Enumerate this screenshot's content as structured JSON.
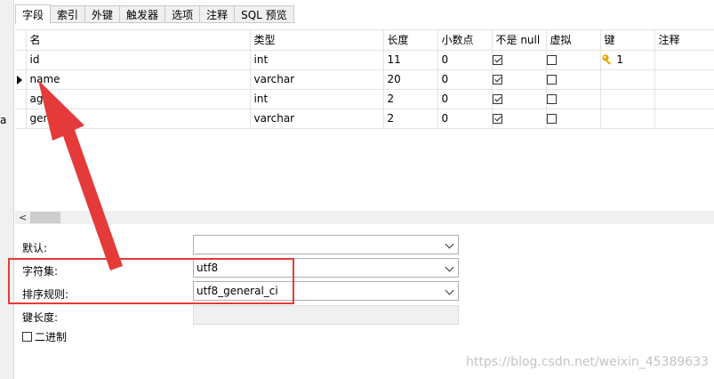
{
  "left_strip_fragment": "a",
  "tabs": [
    {
      "label": "字段",
      "active": true
    },
    {
      "label": "索引",
      "active": false
    },
    {
      "label": "外键",
      "active": false
    },
    {
      "label": "触发器",
      "active": false
    },
    {
      "label": "选项",
      "active": false
    },
    {
      "label": "注释",
      "active": false
    },
    {
      "label": "SQL 预览",
      "active": false
    }
  ],
  "grid": {
    "columns": [
      "名",
      "类型",
      "长度",
      "小数点",
      "不是 null",
      "虚拟",
      "键",
      "注释"
    ],
    "rows": [
      {
        "name": "id",
        "type": "int",
        "length": "11",
        "decimal": "0",
        "not_null": true,
        "virtual": false,
        "key": "1",
        "comment": ""
      },
      {
        "name": "name",
        "type": "varchar",
        "length": "20",
        "decimal": "0",
        "not_null": true,
        "virtual": false,
        "key": "",
        "comment": "",
        "selected": true
      },
      {
        "name": "ag",
        "type": "int",
        "length": "2",
        "decimal": "0",
        "not_null": true,
        "virtual": false,
        "key": "",
        "comment": ""
      },
      {
        "name": "gender",
        "type": "varchar",
        "length": "2",
        "decimal": "0",
        "not_null": true,
        "virtual": false,
        "key": "",
        "comment": ""
      }
    ]
  },
  "props": {
    "default_label": "默认:",
    "default_value": "",
    "charset_label": "字符集:",
    "charset_value": "utf8",
    "collation_label": "排序规则:",
    "collation_value": "utf8_general_ci",
    "key_length_label": "键长度:",
    "binary_label": "二进制"
  },
  "watermark": "https://blog.csdn.net/weixin_45389633",
  "colors": {
    "annotation": "#e53a3a",
    "key_icon": "#e0a800"
  }
}
